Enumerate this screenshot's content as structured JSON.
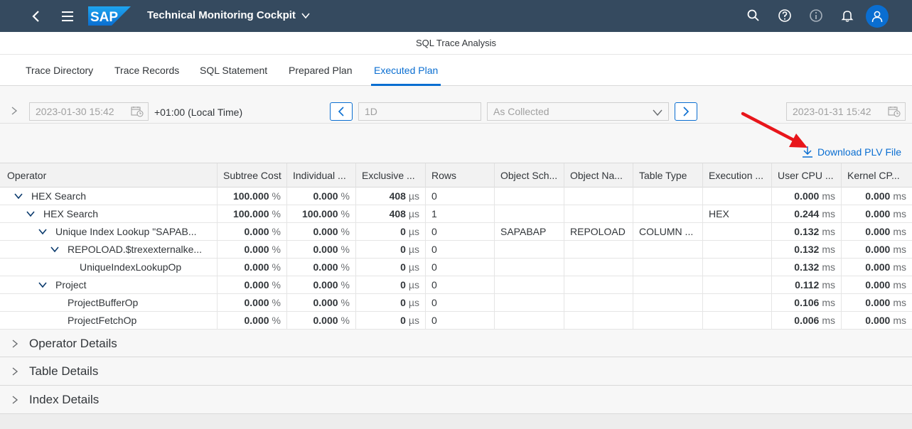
{
  "shell": {
    "app_title": "Technical Monitoring Cockpit",
    "logo_text": "SAP",
    "colors": {
      "shell_bg": "#354a5f",
      "accent": "#0a6ed1"
    }
  },
  "page": {
    "title": "SQL Trace Analysis"
  },
  "tabs": [
    {
      "label": "Trace Directory"
    },
    {
      "label": "Trace Records"
    },
    {
      "label": "SQL Statement"
    },
    {
      "label": "Prepared Plan"
    },
    {
      "label": "Executed Plan",
      "active": true
    }
  ],
  "filter": {
    "from_date": "2023-01-30 15:42",
    "timezone": "+01:00 (Local Time)",
    "interval": "1D",
    "resolution": "As Collected",
    "to_date": "2023-01-31 15:42"
  },
  "toolbar": {
    "download_label": "Download PLV File"
  },
  "table": {
    "columns": [
      "Operator",
      "Subtree Cost",
      "Individual ...",
      "Exclusive ...",
      "Rows",
      "Object Sch...",
      "Object Na...",
      "Table Type",
      "Execution ...",
      "User CPU ...",
      "Kernel CP..."
    ],
    "rows": [
      {
        "operator": "HEX Search",
        "subtree": "100.000",
        "individual": "0.000",
        "exclusive": "408",
        "rows": "0",
        "schema": "",
        "object": "",
        "type": "",
        "execution": "",
        "user_cpu": "0.000",
        "kernel_cpu": "0.000"
      },
      {
        "operator": "HEX Search",
        "subtree": "100.000",
        "individual": "100.000",
        "exclusive": "408",
        "rows": "1",
        "schema": "",
        "object": "",
        "type": "",
        "execution": "HEX",
        "user_cpu": "0.244",
        "kernel_cpu": "0.000"
      },
      {
        "operator": "Unique Index Lookup \"SAPAB...",
        "subtree": "0.000",
        "individual": "0.000",
        "exclusive": "0",
        "rows": "0",
        "schema": "SAPABAP",
        "object": "REPOLOAD",
        "type": "COLUMN ...",
        "execution": "",
        "user_cpu": "0.132",
        "kernel_cpu": "0.000"
      },
      {
        "operator": "REPOLOAD.$trexexternalke...",
        "subtree": "0.000",
        "individual": "0.000",
        "exclusive": "0",
        "rows": "0",
        "schema": "",
        "object": "",
        "type": "",
        "execution": "",
        "user_cpu": "0.132",
        "kernel_cpu": "0.000"
      },
      {
        "operator": "UniqueIndexLookupOp",
        "subtree": "0.000",
        "individual": "0.000",
        "exclusive": "0",
        "rows": "0",
        "schema": "",
        "object": "",
        "type": "",
        "execution": "",
        "user_cpu": "0.132",
        "kernel_cpu": "0.000"
      },
      {
        "operator": "Project",
        "subtree": "0.000",
        "individual": "0.000",
        "exclusive": "0",
        "rows": "0",
        "schema": "",
        "object": "",
        "type": "",
        "execution": "",
        "user_cpu": "0.112",
        "kernel_cpu": "0.000"
      },
      {
        "operator": "ProjectBufferOp",
        "subtree": "0.000",
        "individual": "0.000",
        "exclusive": "0",
        "rows": "0",
        "schema": "",
        "object": "",
        "type": "",
        "execution": "",
        "user_cpu": "0.106",
        "kernel_cpu": "0.000"
      },
      {
        "operator": "ProjectFetchOp",
        "subtree": "0.000",
        "individual": "0.000",
        "exclusive": "0",
        "rows": "0",
        "schema": "",
        "object": "",
        "type": "",
        "execution": "",
        "user_cpu": "0.006",
        "kernel_cpu": "0.000"
      }
    ],
    "units": {
      "percent": "%",
      "micro": "µs",
      "ms": "ms"
    },
    "resize_handle": "...."
  },
  "panels": [
    {
      "label": "Operator Details"
    },
    {
      "label": "Table Details"
    },
    {
      "label": "Index Details"
    }
  ]
}
